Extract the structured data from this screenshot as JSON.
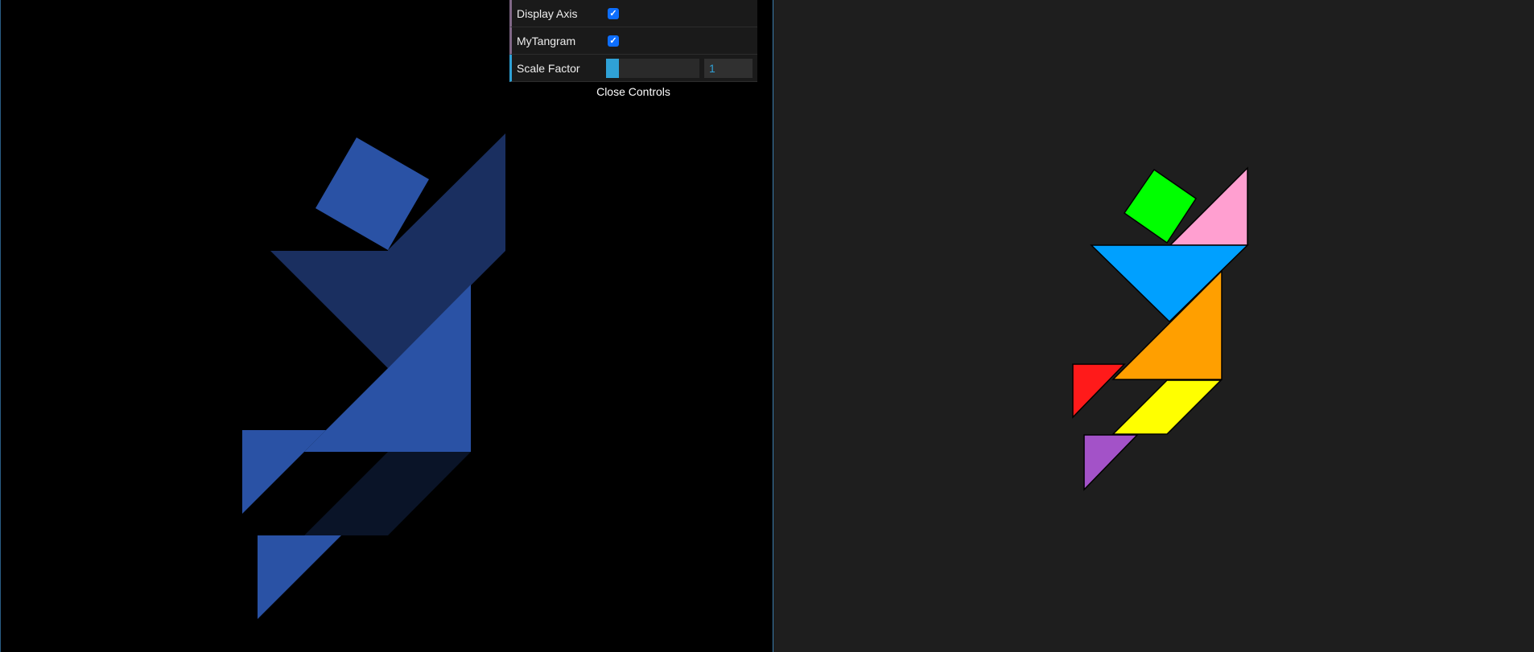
{
  "controls": {
    "display_axis": {
      "label": "Display Axis",
      "checked": true
    },
    "my_tangram": {
      "label": "MyTangram",
      "checked": true
    },
    "scale_factor": {
      "label": "Scale Factor",
      "value": "1",
      "fraction": 0.14
    },
    "close_label": "Close Controls"
  },
  "colors": {
    "left_background": "#000000",
    "right_background": "#1e1e1e",
    "divider": "#3c7fb0",
    "tangram_blue": "#2a52a5",
    "tangram_blue_dark": "#1a2f60",
    "tangram_blue_darker": "#0a1428",
    "green_square": "#00ff00",
    "pink_triangle": "#ff9fd0",
    "blue_triangle": "#00a0ff",
    "orange_triangle": "#ff9f00",
    "red_triangle": "#ff1a1a",
    "yellow_parallelogram": "#ffff00",
    "purple_triangle": "#a352c8"
  }
}
